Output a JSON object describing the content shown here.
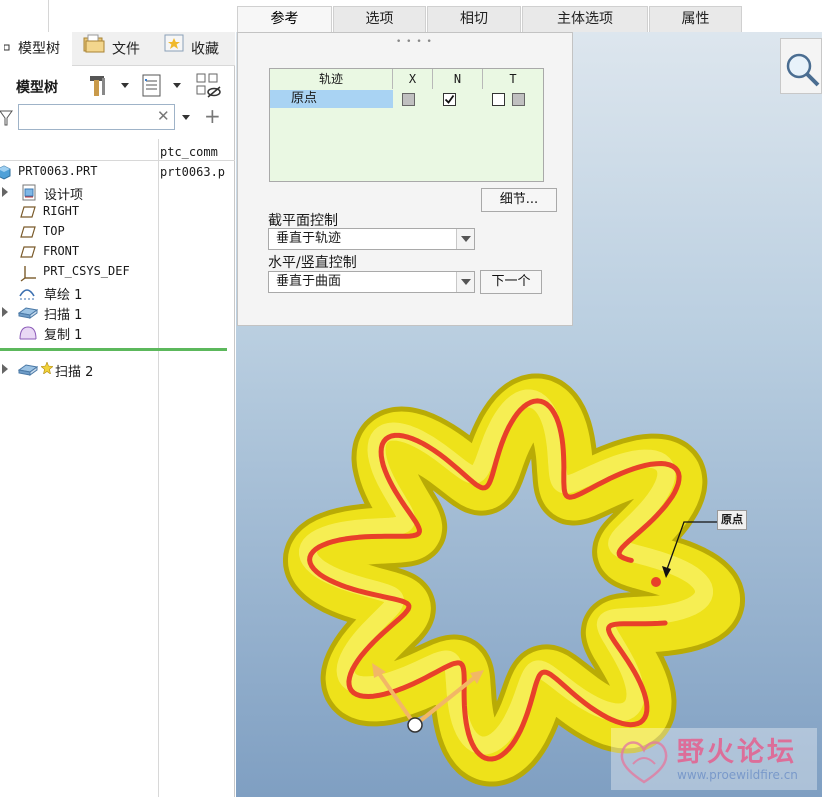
{
  "ribbon": {
    "tabs": [
      {
        "label": "参考",
        "active": true
      },
      {
        "label": "选项",
        "active": false
      },
      {
        "label": "相切",
        "active": false
      },
      {
        "label": "主体选项",
        "active": false
      },
      {
        "label": "属性",
        "active": false
      }
    ]
  },
  "left_panel": {
    "tabs": [
      {
        "label": "模型树",
        "icon": "model-tree-icon"
      },
      {
        "label": "文件",
        "icon": "folder-icon"
      },
      {
        "label": "收藏",
        "icon": "favorites-icon"
      }
    ],
    "title": "模型树",
    "filter_placeholder": "",
    "column_header": "ptc_comm",
    "nodes": [
      {
        "label": "PRT0063.PRT",
        "icon": "part-icon",
        "col2": "prt0063.p",
        "expander": false
      },
      {
        "label": "设计项",
        "icon": "design-items-icon",
        "expander": true
      },
      {
        "label": "RIGHT",
        "icon": "datum-plane-icon",
        "expander": false
      },
      {
        "label": "TOP",
        "icon": "datum-plane-icon",
        "expander": false
      },
      {
        "label": "FRONT",
        "icon": "datum-plane-icon",
        "expander": false
      },
      {
        "label": "PRT_CSYS_DEF",
        "icon": "csys-icon",
        "expander": false
      },
      {
        "label": "草绘 1",
        "icon": "sketch-icon",
        "expander": false
      },
      {
        "label": "扫描 1",
        "icon": "sweep-icon",
        "expander": true
      },
      {
        "label": "复制 1",
        "icon": "copy-icon",
        "expander": false
      },
      {
        "label": "扫描 2",
        "icon": "sweep-icon",
        "expander": true
      }
    ]
  },
  "references": {
    "table": {
      "headers": [
        "轨迹",
        "X",
        "N",
        "T"
      ],
      "rows": [
        {
          "name": "原点",
          "x": false,
          "n": true,
          "t": [
            false,
            false
          ]
        }
      ]
    },
    "detail_button": "细节...",
    "section_label": "截平面控制",
    "section_value": "垂直于轨迹",
    "hv_label": "水平/竖直控制",
    "hv_value": "垂直于曲面",
    "next_button": "下一个"
  },
  "viewport": {
    "origin_label": "原点",
    "colors": {
      "tube": "#f4ec1a",
      "trajectory": "#e8402a",
      "arrows": "#f2b766"
    }
  },
  "watermark": {
    "title": "野火论坛",
    "url": "www.proewildfire.cn"
  }
}
